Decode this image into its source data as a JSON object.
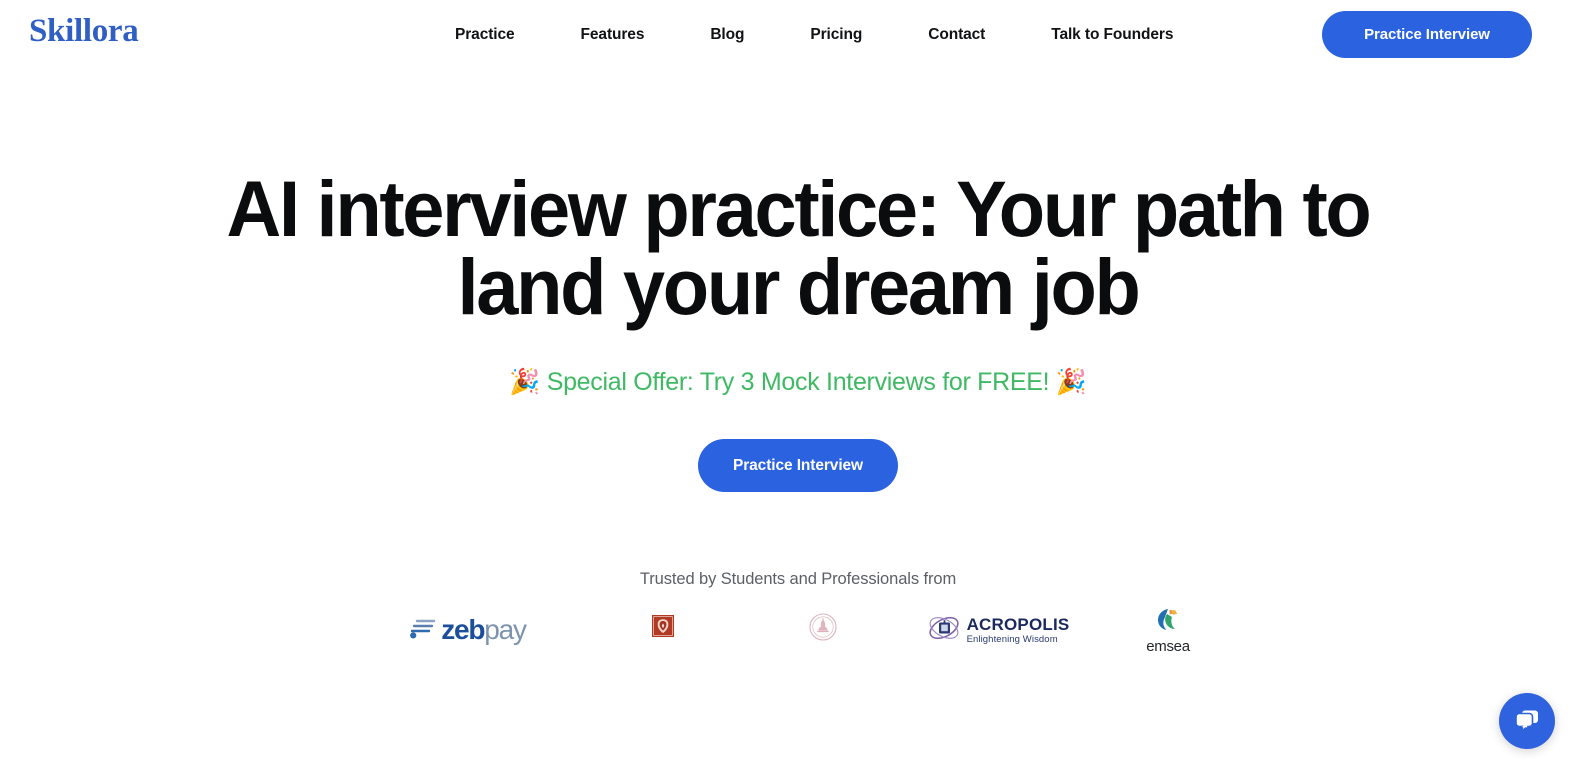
{
  "brand": {
    "name": "Skillora",
    "color": "#2f5fc4"
  },
  "header": {
    "nav": [
      {
        "label": "Practice"
      },
      {
        "label": "Features"
      },
      {
        "label": "Blog"
      },
      {
        "label": "Pricing"
      },
      {
        "label": "Contact"
      },
      {
        "label": "Talk to Founders"
      }
    ],
    "cta_label": "Practice Interview",
    "cta_color": "#2a62e0"
  },
  "hero": {
    "headline": "AI interview practice: Your path to land your dream job",
    "offer_text": "🎉 Special Offer: Try 3 Mock Interviews for FREE! 🎉",
    "offer_color": "#3fb964",
    "cta_label": "Practice Interview"
  },
  "trusted": {
    "caption": "Trusted by Students and Professionals from",
    "logos": [
      {
        "name": "zebpay",
        "text_primary": "zeb",
        "text_secondary": "pay"
      },
      {
        "name": "university-crest",
        "text": ""
      },
      {
        "name": "university-seal",
        "text": ""
      },
      {
        "name": "acropolis",
        "text": "ACROPOLIS",
        "tagline": "Enlightening Wisdom"
      },
      {
        "name": "emsea",
        "text": "emsea"
      }
    ]
  },
  "chat": {
    "label": "Chat",
    "color": "#2f62de"
  }
}
